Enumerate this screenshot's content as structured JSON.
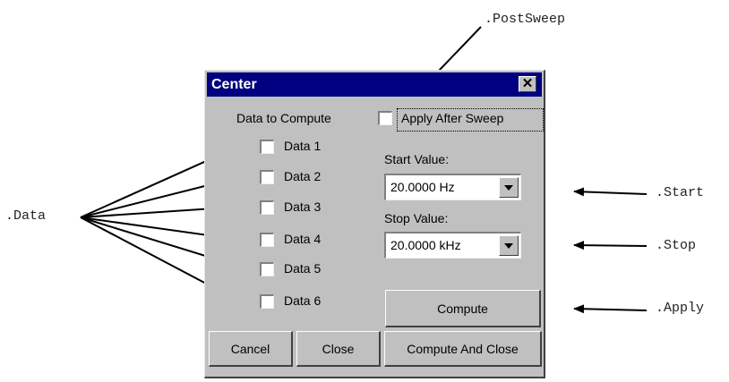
{
  "callouts": {
    "data": ".Data",
    "postsweep": ".PostSweep",
    "start": ".Start",
    "stop": ".Stop",
    "apply": ".Apply"
  },
  "dialog": {
    "title": "Center",
    "close_glyph": "✕",
    "data_to_compute_label": "Data to Compute",
    "apply_after_sweep_label": "Apply After Sweep",
    "data_items": [
      "Data 1",
      "Data 2",
      "Data 3",
      "Data 4",
      "Data 5",
      "Data 6"
    ],
    "start_value_label": "Start Value:",
    "start_value": "20.0000  Hz",
    "stop_value_label": "Stop Value:",
    "stop_value": "20.0000 kHz",
    "compute_label": "Compute",
    "cancel_label": "Cancel",
    "close_label": "Close",
    "compute_and_close_label": "Compute And Close"
  }
}
